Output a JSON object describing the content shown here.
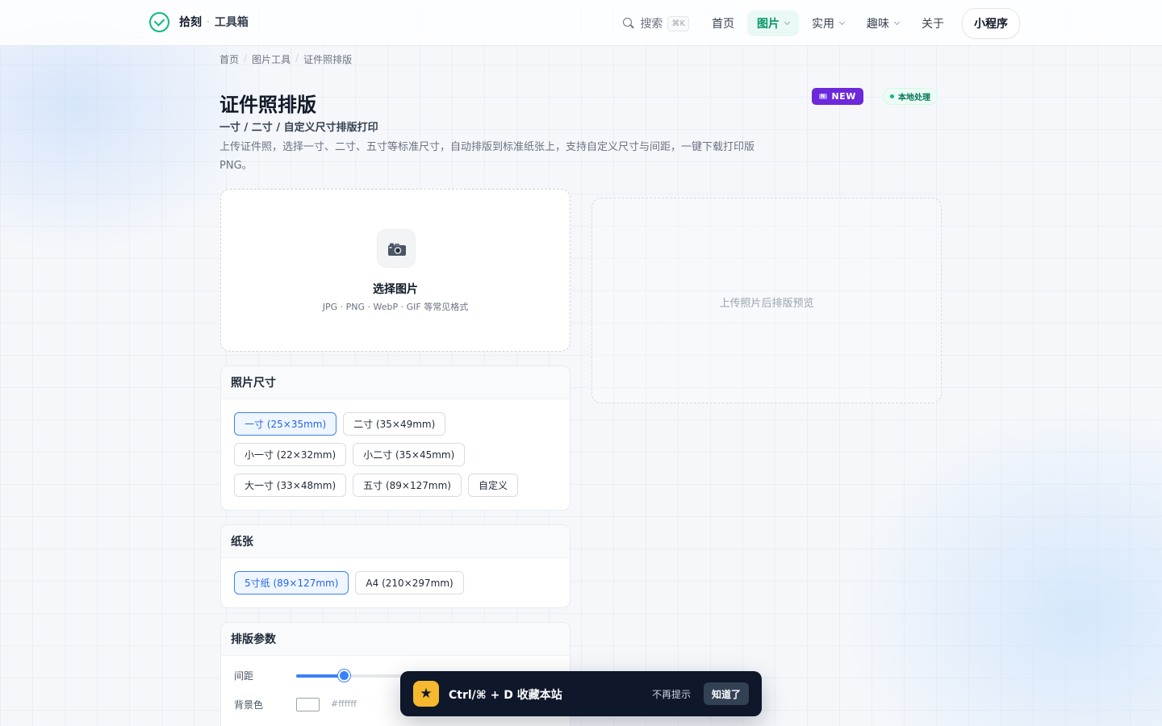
{
  "brand": {
    "name": "拾刻",
    "separator": "·",
    "subtitle": "工具箱"
  },
  "nav": {
    "search_label": "搜索",
    "search_shortcut": "⌘K",
    "items": [
      {
        "label": "首页",
        "has_menu": false
      },
      {
        "label": "图片",
        "has_menu": true,
        "active": true
      },
      {
        "label": "实用",
        "has_menu": true
      },
      {
        "label": "趣味",
        "has_menu": true
      },
      {
        "label": "关于",
        "has_menu": false
      }
    ],
    "mini_program_label": "小程序"
  },
  "breadcrumb": [
    "首页",
    "图片工具",
    "证件照排版"
  ],
  "page": {
    "title": "证件照排版",
    "subtitle": "一寸 / 二寸 / 自定义尺寸排版打印",
    "description": "上传证件照，选择一寸、二寸、五寸等标准尺寸，自动排版到标准纸张上，支持自定义尺寸与间距，一键下载打印版 PNG。",
    "badge_new": "NEW",
    "badge_new_mark": "N",
    "badge_local": "本地处理"
  },
  "upload": {
    "title": "选择图片",
    "hint": "JPG · PNG · WebP · GIF 等常见格式",
    "icon": "camera-icon"
  },
  "preview": {
    "placeholder": "上传照片后排版预览"
  },
  "photo_size": {
    "title": "照片尺寸",
    "options": [
      "一寸 (25×35mm)",
      "二寸 (35×49mm)",
      "小一寸 (22×32mm)",
      "小二寸 (35×45mm)",
      "大一寸 (33×48mm)",
      "五寸 (89×127mm)",
      "自定义"
    ],
    "selected_index": 0
  },
  "paper": {
    "title": "纸张",
    "options": [
      "5寸纸 (89×127mm)",
      "A4 (210×297mm)"
    ],
    "selected_index": 0
  },
  "layout_params": {
    "title": "排版参数",
    "spacing_label": "间距",
    "spacing_fraction": 0.42,
    "bg_label": "背景色",
    "bg_color": "#ffffff",
    "bg_value": "#ffffff"
  },
  "toast": {
    "icon": "star-icon",
    "text": "Ctrl/⌘ + D 收藏本站",
    "dismiss_label": "不再提示",
    "ok_label": "知道了"
  },
  "colors": {
    "accent_green": "#10b981",
    "accent_blue": "#3b82f6",
    "new_badge": "#6d28d9",
    "toast_bg": "#0f172a",
    "toast_star": "#f5b82e"
  }
}
